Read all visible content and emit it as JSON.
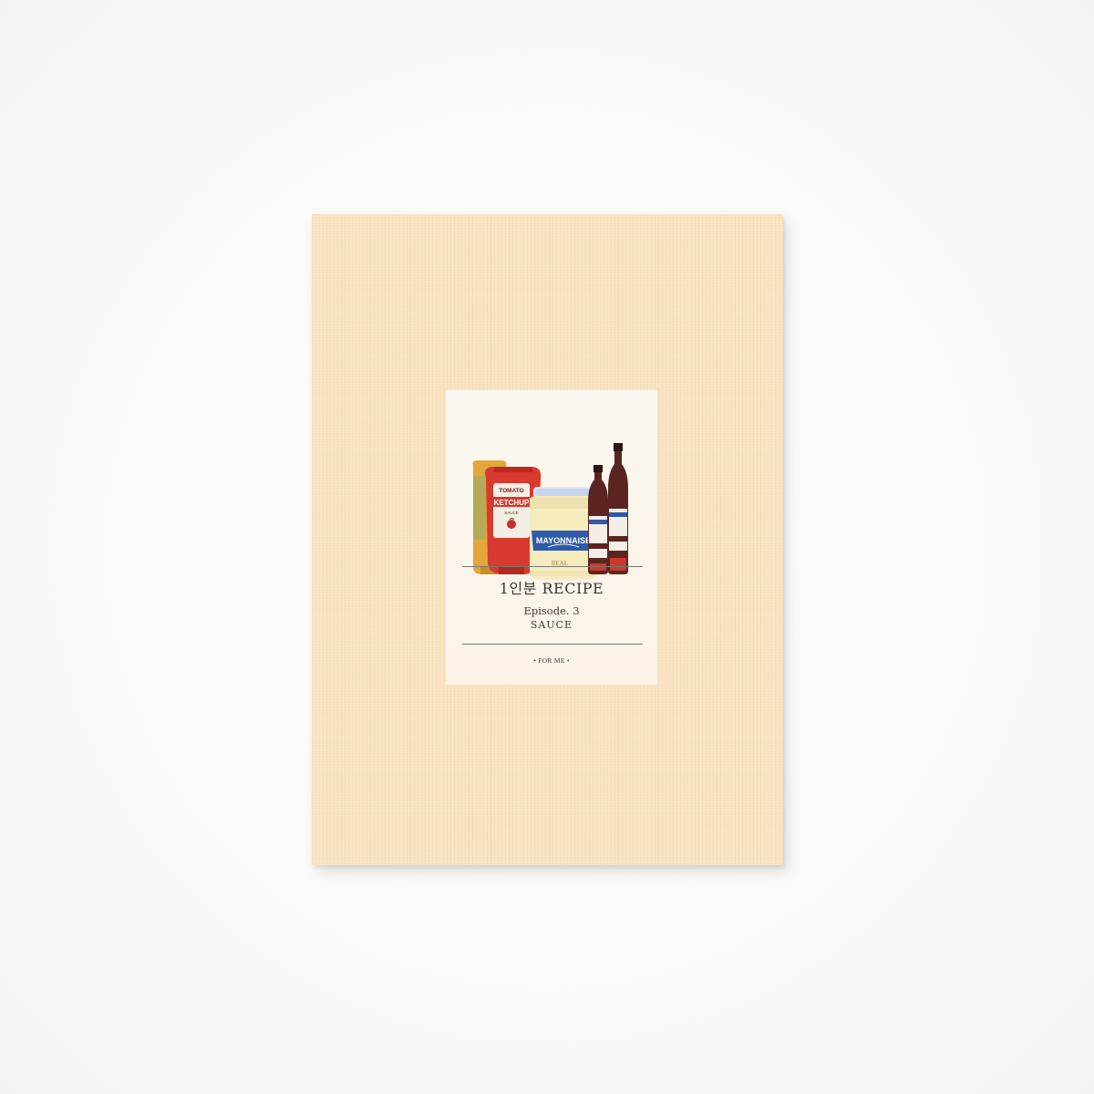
{
  "cover": {
    "title": "1인분 RECIPE",
    "episode": "Episode. 3",
    "subtitle": "SAUCE",
    "footer": "• FOR ME •"
  },
  "illustration": {
    "items": [
      {
        "name": "tomato-ketchup-bottle",
        "label_top": "TOMATO",
        "label_main": "KETCHUP",
        "label_sub": "SAUCE"
      },
      {
        "name": "mayonnaise-jar",
        "label_main": "MAYONNAISE",
        "label_sub": "REAL"
      },
      {
        "name": "sauce-bottle-left"
      },
      {
        "name": "sauce-bottle-right"
      }
    ]
  },
  "colors": {
    "cover_background": "#f8e2c0",
    "label_background": "#fbf7f0",
    "ketchup_red": "#d83a2f",
    "mustard_yellow": "#e3a63b",
    "mayo_blue": "#2e5aa8",
    "brown_sauce": "#5a2520"
  }
}
